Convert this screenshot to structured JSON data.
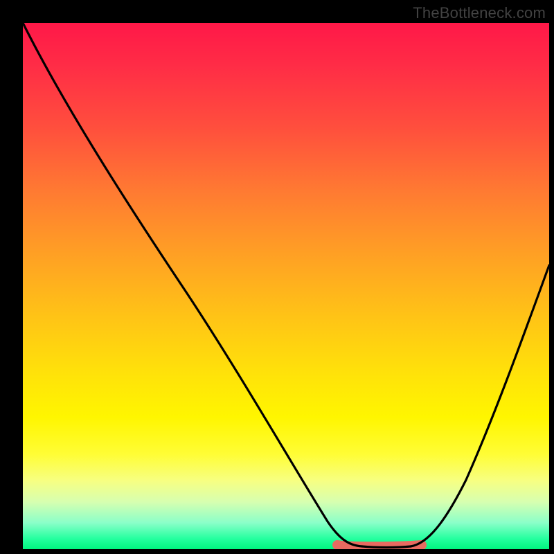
{
  "watermark": "TheBottleneck.com",
  "chart_data": {
    "type": "line",
    "title": "",
    "xlabel": "",
    "ylabel": "",
    "xlim": [
      0,
      100
    ],
    "ylim": [
      0,
      100
    ],
    "grid": false,
    "legend": false,
    "background": "red-yellow-green vertical gradient",
    "series": [
      {
        "name": "left-branch",
        "x": [
          0,
          12,
          25,
          38,
          50,
          57,
          60,
          64
        ],
        "values": [
          100,
          82,
          63,
          44,
          25,
          10,
          3,
          0.5
        ]
      },
      {
        "name": "bottom-flat",
        "x": [
          64,
          66,
          70,
          74,
          76
        ],
        "values": [
          0.5,
          0.3,
          0.2,
          0.3,
          0.5
        ]
      },
      {
        "name": "right-branch",
        "x": [
          76,
          80,
          85,
          90,
          95,
          100
        ],
        "values": [
          0.5,
          4,
          12,
          24,
          38,
          54
        ]
      }
    ],
    "marker": {
      "name": "optimum-band",
      "color": "#e96a60",
      "x_range": [
        60,
        76
      ],
      "y": 0.6,
      "thickness_pct": 1.8
    }
  },
  "colors": {
    "curve": "#000000",
    "marker": "#e96a60",
    "frame": "#000000"
  }
}
